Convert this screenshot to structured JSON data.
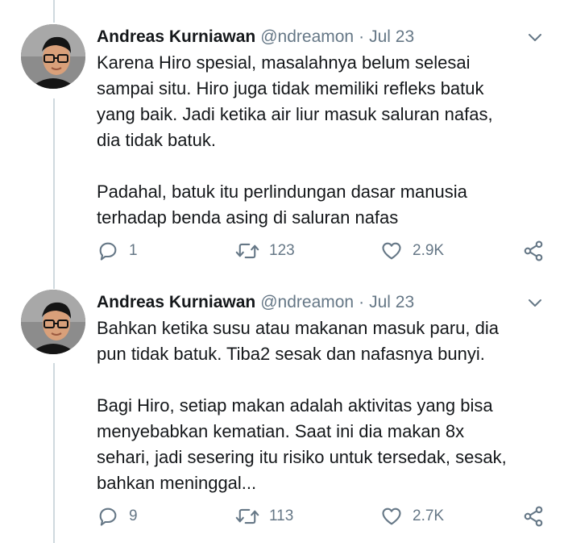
{
  "tweets": [
    {
      "name": "Andreas Kurniawan",
      "handle": "@ndreamon",
      "separator": "·",
      "date": "Jul 23",
      "body": "Karena Hiro spesial, masalahnya belum selesai\nsampai situ. Hiro juga tidak memiliki refleks batuk\nyang baik. Jadi ketika air liur masuk saluran nafas,\ndia tidak batuk.\n\nPadahal, batuk itu perlindungan dasar manusia\nterhadap benda asing di saluran nafas",
      "replies": "1",
      "retweets": "123",
      "likes": "2.9K"
    },
    {
      "name": "Andreas Kurniawan",
      "handle": "@ndreamon",
      "separator": "·",
      "date": "Jul 23",
      "body": "Bahkan ketika susu atau makanan masuk paru, dia\npun tidak batuk. Tiba2 sesak dan nafasnya bunyi.\n\nBagi Hiro, setiap makan adalah aktivitas yang bisa\nmenyebabkan kematian. Saat ini dia makan 8x\nsehari, jadi sesering itu risiko untuk tersedak, sesak,\nbahkan meninggal...",
      "replies": "9",
      "retweets": "113",
      "likes": "2.7K"
    }
  ],
  "icons": {
    "reply": "reply-icon",
    "retweet": "retweet-icon",
    "like": "heart-icon",
    "share": "share-icon",
    "more": "chevron-down-icon"
  },
  "colors": {
    "name": "#14171a",
    "secondary": "#657786",
    "thread_line": "#cfd9de"
  }
}
